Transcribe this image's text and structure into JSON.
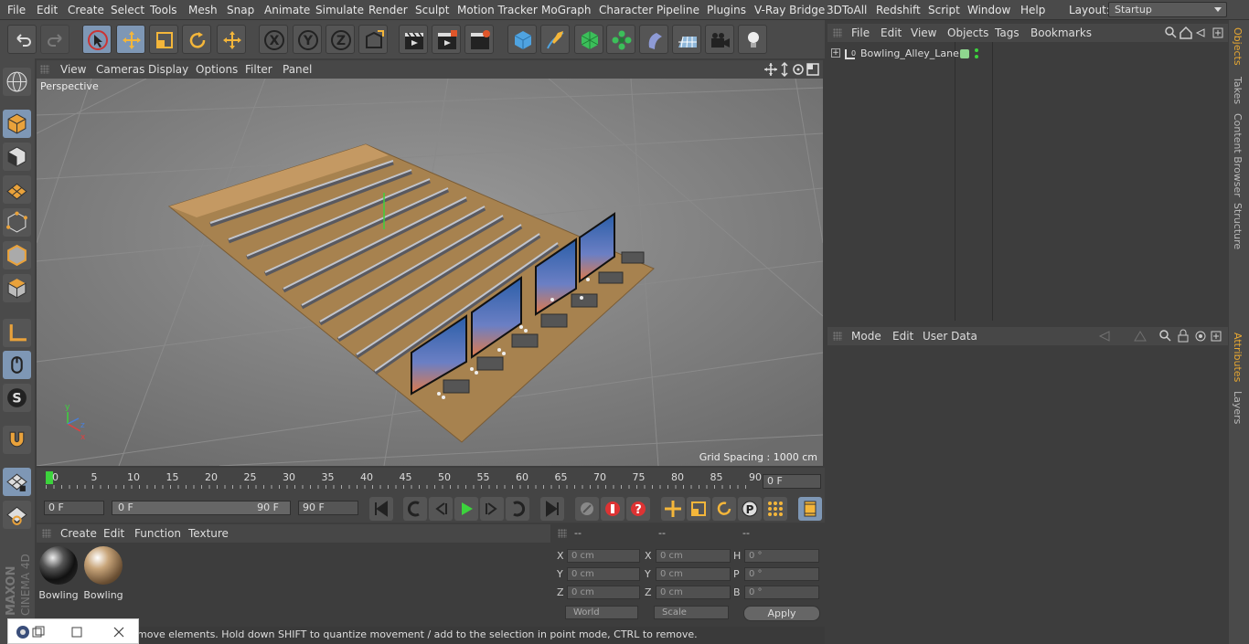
{
  "menubar": {
    "items": [
      "File",
      "Edit",
      "Create",
      "Select",
      "Tools",
      "Mesh",
      "Snap",
      "Animate",
      "Simulate",
      "Render",
      "Sculpt",
      "Motion Tracker",
      "MoGraph",
      "Character",
      "Pipeline",
      "Plugins",
      "V-Ray Bridge",
      "3DToAll",
      "Redshift",
      "Script",
      "Window",
      "Help"
    ],
    "layout_label": "Layout:",
    "layout_value": "Startup"
  },
  "viewport": {
    "menu": [
      "View",
      "Cameras",
      "Display",
      "Options",
      "Filter",
      "Panel"
    ],
    "label": "Perspective",
    "grid_spacing": "Grid Spacing : 1000 cm"
  },
  "timeline": {
    "ticks": [
      "0",
      "5",
      "10",
      "15",
      "20",
      "25",
      "30",
      "35",
      "40",
      "45",
      "50",
      "55",
      "60",
      "65",
      "70",
      "75",
      "80",
      "85",
      "90"
    ],
    "current_frame": "0 F"
  },
  "transport": {
    "start_field": "0 F",
    "range_start": "0 F",
    "range_end": "90 F",
    "end_field": "90 F"
  },
  "material_manager": {
    "menu": [
      "Create",
      "Edit",
      "Function",
      "Texture"
    ],
    "materials": [
      {
        "label": "Bowling",
        "icon": "material-ball-dark-icon"
      },
      {
        "label": "Bowling",
        "icon": "material-ball-wood-icon"
      }
    ]
  },
  "coordinates": {
    "headers": [
      "--",
      "--",
      "--"
    ],
    "rows": [
      {
        "a": "X",
        "av": "0 cm",
        "b": "X",
        "bv": "0 cm",
        "c": "H",
        "cv": "0 °"
      },
      {
        "a": "Y",
        "av": "0 cm",
        "b": "Y",
        "bv": "0 cm",
        "c": "P",
        "cv": "0 °"
      },
      {
        "a": "Z",
        "av": "0 cm",
        "b": "Z",
        "bv": "0 cm",
        "c": "B",
        "cv": "0 °"
      }
    ],
    "world": "World",
    "scale": "Scale",
    "apply": "Apply"
  },
  "status": "move elements. Hold down SHIFT to quantize movement / add to the selection in point mode, CTRL to remove.",
  "object_manager": {
    "menu": [
      "File",
      "Edit",
      "View",
      "Objects",
      "Tags",
      "Bookmarks"
    ],
    "objects": [
      {
        "name": "Bowling_Alley_Lane"
      }
    ]
  },
  "attribute_manager": {
    "menu": [
      "Mode",
      "Edit",
      "User Data"
    ]
  },
  "side_tabs": [
    "Objects",
    "Takes",
    "Content Browser",
    "Structure",
    "Attributes",
    "Layers"
  ],
  "brand": {
    "line1": "MAXON",
    "line2": "CINEMA 4D"
  },
  "colors": {
    "accent": "#7e97b5",
    "active_tab": "#e8a832",
    "play": "#3cd33c"
  }
}
